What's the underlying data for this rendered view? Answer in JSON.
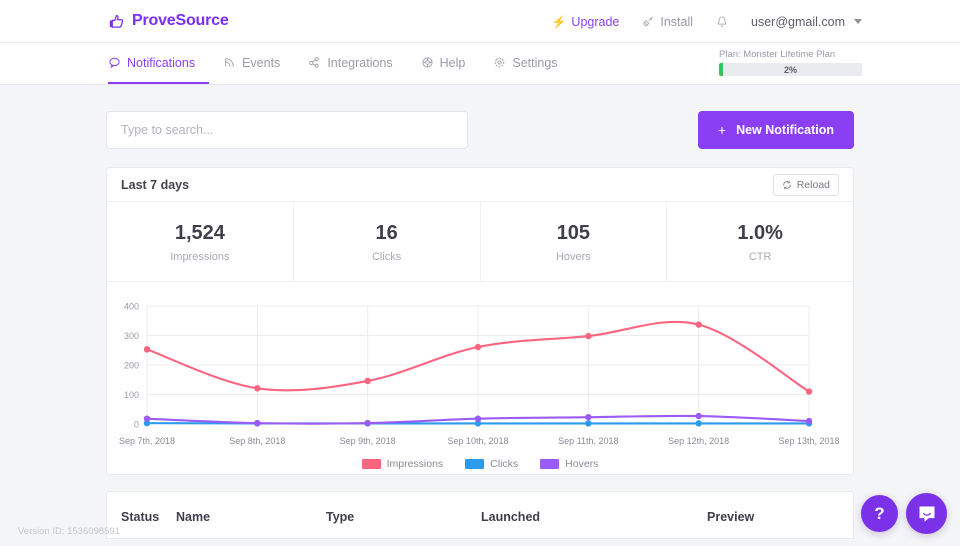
{
  "brand": {
    "name": "ProveSource",
    "color": "#7a2ff4",
    "logo_icon": "thumbs-up-icon"
  },
  "topbar": {
    "upgrade": {
      "label": "Upgrade",
      "icon": "bolt-icon",
      "color": "#8b3ff5"
    },
    "install": {
      "label": "Install",
      "icon": "plug-icon"
    },
    "notifications_bell": {
      "icon": "bell-icon"
    },
    "account": {
      "email": "user@gmail.com",
      "icon": "chevron-down-icon"
    }
  },
  "nav": {
    "items": [
      {
        "label": "Notifications",
        "icon": "chat-bubble-icon",
        "active": true
      },
      {
        "label": "Events",
        "icon": "rss-icon",
        "active": false
      },
      {
        "label": "Integrations",
        "icon": "share-nodes-icon",
        "active": false
      },
      {
        "label": "Help",
        "icon": "lifebuoy-icon",
        "active": false
      },
      {
        "label": "Settings",
        "icon": "gear-icon",
        "active": false
      }
    ]
  },
  "plan": {
    "label": "Plan: Monster Lifetime Plan",
    "percent_label": "2%",
    "percent_value": 2,
    "fill_color": "#34c759"
  },
  "search": {
    "placeholder": "Type to search...",
    "value": "",
    "icon": "search-input"
  },
  "new_notification_button": {
    "label": "New Notification",
    "plus": "+",
    "color": "#8b3ff5"
  },
  "stats_card": {
    "title": "Last 7 days",
    "reload_label": "Reload",
    "reload_icon": "refresh-icon",
    "stats": [
      {
        "value": "1,524",
        "label": "Impressions"
      },
      {
        "value": "16",
        "label": "Clicks"
      },
      {
        "value": "105",
        "label": "Hovers"
      },
      {
        "value": "1.0%",
        "label": "CTR"
      }
    ]
  },
  "chart_data": {
    "type": "line",
    "title": "",
    "xlabel": "",
    "ylabel": "",
    "ylim": [
      0,
      400
    ],
    "yticks": [
      0,
      100,
      200,
      300,
      400
    ],
    "grid": true,
    "legend_position": "bottom",
    "categories": [
      "Sep 7th, 2018",
      "Sep 8th, 2018",
      "Sep 9th, 2018",
      "Sep 10th, 2018",
      "Sep 11th, 2018",
      "Sep 12th, 2018",
      "Sep 13th, 2018"
    ],
    "series": [
      {
        "name": "Impressions",
        "color": "#fb6580",
        "values": [
          253,
          121,
          146,
          261,
          298,
          337,
          110
        ]
      },
      {
        "name": "Clicks",
        "color": "#2b9bee",
        "values": [
          3,
          2,
          2,
          2,
          2,
          2,
          2
        ]
      },
      {
        "name": "Hovers",
        "color": "#9b5cf6",
        "values": [
          18,
          3,
          3,
          18,
          23,
          27,
          10
        ]
      }
    ]
  },
  "table": {
    "columns": [
      "Status",
      "Name",
      "Type",
      "Launched",
      "Preview"
    ]
  },
  "footer": {
    "version": "Version ID: 1536098591"
  },
  "floating": {
    "help": {
      "label": "?",
      "icon": "question-mark-icon"
    },
    "chat": {
      "icon": "intercom-chat-icon"
    }
  }
}
